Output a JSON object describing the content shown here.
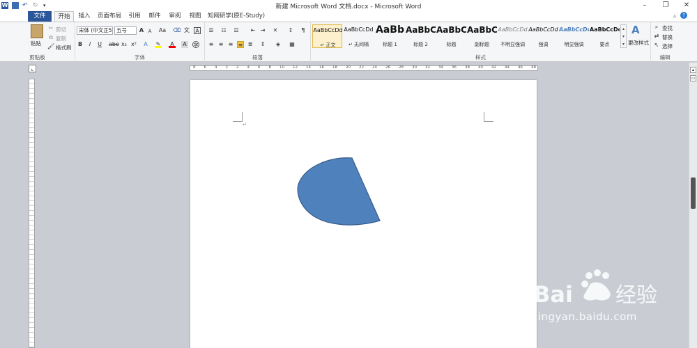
{
  "window": {
    "title": "新建 Microsoft Word 文档.docx - Microsoft Word"
  },
  "tabs": [
    {
      "label": "文件"
    },
    {
      "label": "开始"
    },
    {
      "label": "插入"
    },
    {
      "label": "页面布局"
    },
    {
      "label": "引用"
    },
    {
      "label": "邮件"
    },
    {
      "label": "审阅"
    },
    {
      "label": "视图"
    },
    {
      "label": "知网研学(原E-Study)"
    }
  ],
  "clipboard": {
    "paste": "粘贴",
    "cut": "剪切",
    "copy": "复制",
    "format_painter": "格式刷",
    "group": "剪贴板"
  },
  "font": {
    "name": "宋体 (中文正5",
    "size": "五号",
    "group": "字体",
    "bold": "B",
    "italic": "I",
    "underline": "U",
    "strike": "abe",
    "subscript": "x₂",
    "superscript": "x²",
    "grow": "A",
    "shrink": "A",
    "case": "Aa",
    "color": "A"
  },
  "paragraph": {
    "group": "段落"
  },
  "styles": {
    "group": "样式",
    "change": "更改样式",
    "items": [
      {
        "sample": "AaBbCcDd",
        "name": "↵ 正文"
      },
      {
        "sample": "AaBbCcDd",
        "name": "↵ 无间隔"
      },
      {
        "sample": "AaBb",
        "name": "标题 1"
      },
      {
        "sample": "AaBbC",
        "name": "标题 2"
      },
      {
        "sample": "AaBbC",
        "name": "标题"
      },
      {
        "sample": "AaBbC",
        "name": "副标题"
      },
      {
        "sample": "AaBbCcDd",
        "name": "不明显强调"
      },
      {
        "sample": "AaBbCcDd",
        "name": "强调"
      },
      {
        "sample": "AaBbCcDc",
        "name": "明显强调"
      },
      {
        "sample": "AaBbCcDc",
        "name": "要点"
      }
    ]
  },
  "editing": {
    "find": "查找",
    "replace": "替换",
    "select": "选择",
    "group": "编辑"
  },
  "ruler": {
    "marks": [
      "8",
      "6",
      "4",
      "2",
      "2",
      "4",
      "6",
      "8",
      "10",
      "12",
      "14",
      "16",
      "18",
      "20",
      "22",
      "24",
      "26",
      "28",
      "30",
      "32",
      "34",
      "36",
      "38",
      "40",
      "42",
      "44",
      "46",
      "48"
    ]
  },
  "document": {
    "paragraph_mark": "↵",
    "shape_color": "#4f81bd",
    "shape_border": "#385d8a"
  },
  "watermark": {
    "text": "jingyan.baidu.com"
  },
  "colors": {
    "file_tab": "#2b579a",
    "ribbon_bg": "#f5f6f7"
  }
}
